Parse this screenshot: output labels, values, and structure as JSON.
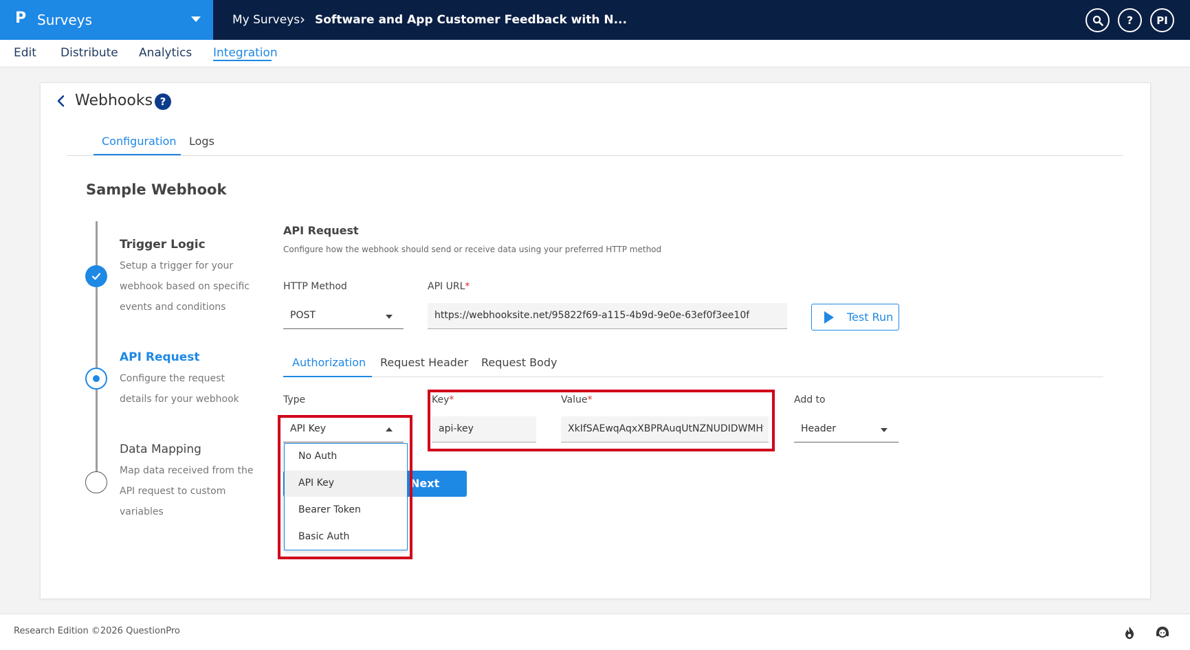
{
  "header": {
    "app_name": "Surveys",
    "breadcrumb_root": "My Surveys",
    "breadcrumb_sep": "›",
    "breadcrumb_current": "Software and App Customer Feedback with N...",
    "search_icon": "search-icon",
    "help_label": "?",
    "user_initials": "PI"
  },
  "nav": {
    "items": [
      {
        "label": "Edit"
      },
      {
        "label": "Distribute"
      },
      {
        "label": "Analytics"
      },
      {
        "label": "Integration"
      }
    ],
    "active": "Integration"
  },
  "page": {
    "title": "Webhooks",
    "help_label": "?",
    "tabs": [
      {
        "label": "Configuration"
      },
      {
        "label": "Logs"
      }
    ],
    "webhook_name": "Sample Webhook"
  },
  "steps": [
    {
      "title": "Trigger Logic",
      "desc": "Setup a trigger for your webhook based on specific events and conditions",
      "state": "done"
    },
    {
      "title": "API Request",
      "desc": "Configure the request details for your webhook",
      "state": "current"
    },
    {
      "title": "Data Mapping",
      "desc": "Map data received from the API request to custom variables",
      "state": "todo"
    }
  ],
  "api_request": {
    "title": "API Request",
    "desc": "Configure how the webhook should send or receive data using your preferred HTTP method",
    "http_method_label": "HTTP Method",
    "http_method_value": "POST",
    "api_url_label": "API URL",
    "required_mark": "*",
    "api_url_value": "https://webhooksite.net/95822f69-a115-4b9d-9e0e-63ef0f3ee10f",
    "test_run_label": "Test Run"
  },
  "sub_tabs": [
    {
      "label": "Authorization"
    },
    {
      "label": "Request Header"
    },
    {
      "label": "Request Body"
    }
  ],
  "auth": {
    "type_label": "Type",
    "type_value": "API Key",
    "key_label": "Key",
    "key_value": "api-key",
    "value_label": "Value",
    "value_value": "XkIfSAEwqAqxXBPRAuqUtNZNUDIDWMHt",
    "add_to_label": "Add to",
    "add_to_value": "Header",
    "options": [
      "No Auth",
      "API Key",
      "Bearer Token",
      "Basic Auth"
    ],
    "selected_option": "API Key"
  },
  "next_label": "Next",
  "footer": {
    "text": "Research Edition ©2026 QuestionPro"
  },
  "colors": {
    "accent": "#1e88e5",
    "topbar": "#0a1f44",
    "highlight": "#d0021b"
  }
}
